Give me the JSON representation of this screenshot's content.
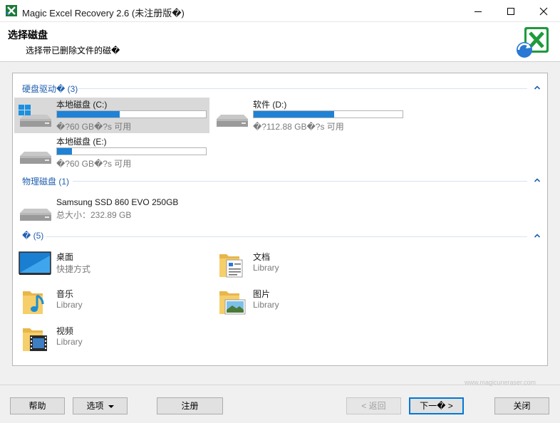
{
  "window": {
    "title": "Magic Excel Recovery 2.6 (未注册版�)",
    "minimize_icon": "minimize-icon",
    "maximize_icon": "maximize-icon",
    "close_icon": "close-icon"
  },
  "header": {
    "title": "选择磁盘",
    "subtitle": "选择带已删除文件的磁�",
    "logo_icon": "excel-recovery-logo"
  },
  "groups": {
    "hard_drives": {
      "label": "硬盘驱动� (3)",
      "items": [
        {
          "name": "本地磁盘 (C:)",
          "free": "�?60 GB�?s 可用",
          "used_fraction": 0.42,
          "icon": "windows-drive-icon",
          "selected": true
        },
        {
          "name": "软件 (D:)",
          "free": "�?112.88 GB�?s 可用",
          "used_fraction": 0.54,
          "icon": "hard-drive-icon",
          "selected": false
        },
        {
          "name": "本地磁盘 (E:)",
          "free": "�?60 GB�?s 可用",
          "used_fraction": 0.1,
          "icon": "hard-drive-icon",
          "selected": false
        }
      ]
    },
    "physical": {
      "label": "物理磁盘  (1)",
      "items": [
        {
          "name": "Samsung SSD 860 EVO 250GB",
          "sub": "总大小：232.89 GB",
          "icon": "hard-drive-icon"
        }
      ]
    },
    "folders": {
      "label": "� (5)",
      "items": [
        {
          "name": "桌面",
          "sub": "快捷方式",
          "icon": "desktop-icon"
        },
        {
          "name": "文档",
          "sub": "Library",
          "icon": "documents-folder-icon"
        },
        {
          "name": "音乐",
          "sub": "Library",
          "icon": "music-folder-icon"
        },
        {
          "name": "图片",
          "sub": "Library",
          "icon": "pictures-folder-icon"
        },
        {
          "name": "视频",
          "sub": "Library",
          "icon": "videos-folder-icon"
        }
      ]
    }
  },
  "buttons": {
    "help": "帮助",
    "options": "选项",
    "register": "注册",
    "back": "< 返回",
    "next": "下一� >",
    "close": "关闭"
  },
  "watermark": "www.magicuneraser.com",
  "colors": {
    "accent": "#1e82d6",
    "group_label": "#1f5fb0",
    "selected_bg": "#d9d9d9"
  }
}
